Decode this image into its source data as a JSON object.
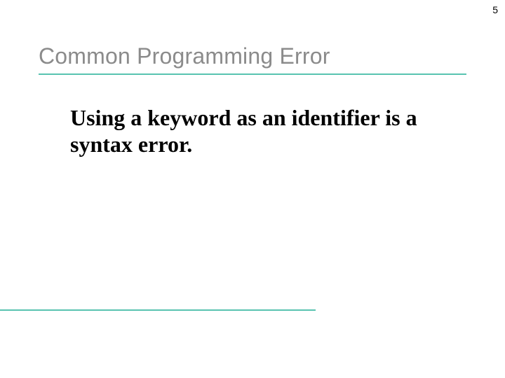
{
  "page": {
    "number": "5"
  },
  "title": {
    "text": "Common Programming Error"
  },
  "body": {
    "text": "Using a keyword as an identifier is a syntax error."
  },
  "theme": {
    "accent": "#58c3b0",
    "title_color": "#8b8b8b"
  }
}
